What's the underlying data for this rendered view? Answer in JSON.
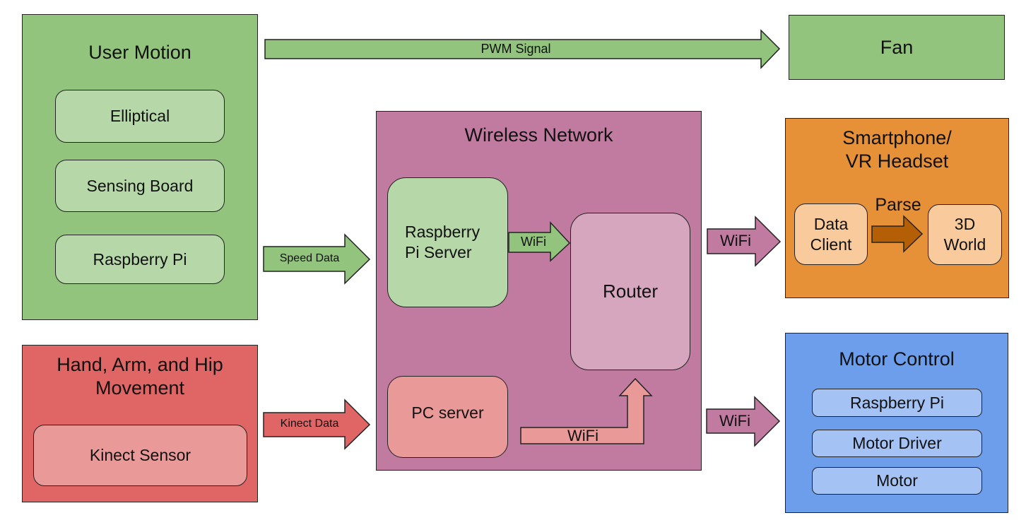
{
  "colors": {
    "green_outer": "#93c47d",
    "green_inner": "#b6d7a8",
    "red_outer": "#e06666",
    "red_inner": "#ea9999",
    "purple_outer": "#c27ba0",
    "purple_inner": "#d5a6bd",
    "orange_outer": "#e69138",
    "orange_inner": "#f9cb9c",
    "orange_arrow": "#b45f06",
    "blue_outer": "#6d9eeb",
    "blue_inner": "#a4c2f4"
  },
  "user_motion": {
    "title": "User Motion",
    "items": [
      "Elliptical",
      "Sensing Board",
      "Raspberry Pi"
    ]
  },
  "hand_arm_hip": {
    "title_line1": "Hand, Arm, and Hip",
    "title_line2": "Movement",
    "items": [
      "Kinect Sensor"
    ]
  },
  "wireless_network": {
    "title": "Wireless Network",
    "rpi_server_line1": "Raspberry",
    "rpi_server_line2": "Pi Server",
    "router": "Router",
    "pc_server": "PC server"
  },
  "fan": {
    "title": "Fan"
  },
  "smartphone": {
    "title_line1": "Smartphone/",
    "title_line2": "VR Headset",
    "data_client_line1": "Data",
    "data_client_line2": "Client",
    "world_line1": "3D",
    "world_line2": "World",
    "parse_label": "Parse"
  },
  "motor_control": {
    "title": "Motor Control",
    "items": [
      "Raspberry Pi",
      "Motor Driver",
      "Motor"
    ]
  },
  "arrows": {
    "pwm": "PWM Signal",
    "speed": "Speed Data",
    "kinect": "Kinect Data",
    "wifi_rpi_router": "WiFi",
    "wifi_pc_router": "WiFi",
    "wifi_to_phone": "WiFi",
    "wifi_to_motor": "WiFi"
  }
}
